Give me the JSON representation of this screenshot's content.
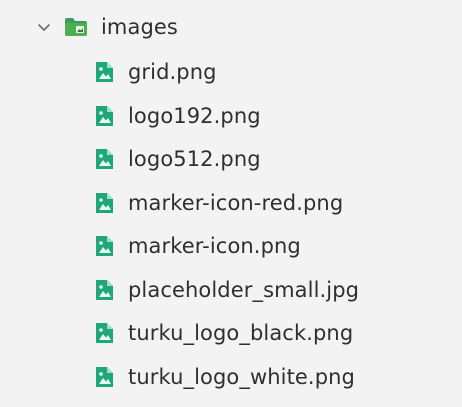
{
  "explorer": {
    "folder": {
      "name": "images",
      "expanded": true,
      "chevron_icon": "chevron-down-icon",
      "icon": "folder-images-icon",
      "icon_color": "#4caf50"
    },
    "files": [
      {
        "name": "grid.png",
        "icon": "image-file-icon"
      },
      {
        "name": "logo192.png",
        "icon": "image-file-icon"
      },
      {
        "name": "logo512.png",
        "icon": "image-file-icon"
      },
      {
        "name": "marker-icon-red.png",
        "icon": "image-file-icon"
      },
      {
        "name": "marker-icon.png",
        "icon": "image-file-icon"
      },
      {
        "name": "placeholder_small.jpg",
        "icon": "image-file-icon"
      },
      {
        "name": "turku_logo_black.png",
        "icon": "image-file-icon"
      },
      {
        "name": "turku_logo_white.png",
        "icon": "image-file-icon"
      }
    ],
    "colors": {
      "background": "#f3f3f3",
      "text": "#2f2f2f",
      "image_icon": "#1fa67a",
      "chevron": "#6b6b6b"
    }
  }
}
